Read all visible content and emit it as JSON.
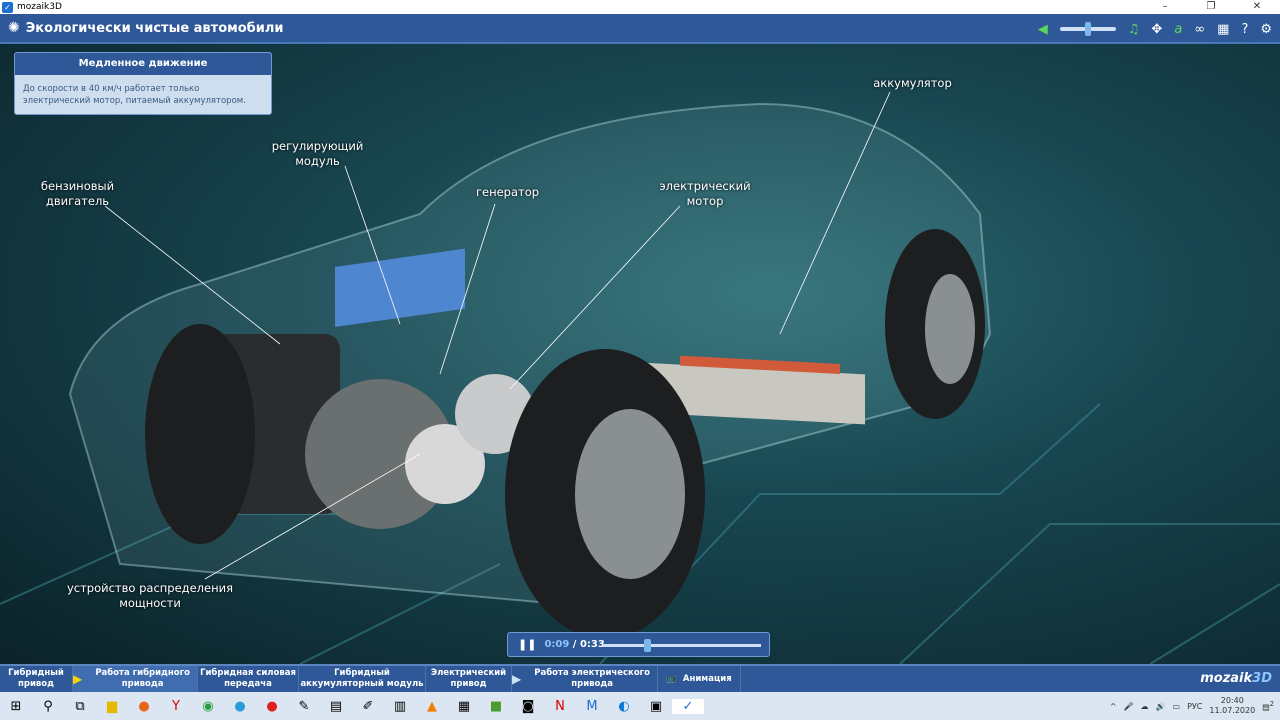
{
  "window": {
    "title": "mozaik3D",
    "controls": [
      "–",
      "❐",
      "✕"
    ]
  },
  "header": {
    "title": "Экологически чистые автомобили",
    "volume": 0.5
  },
  "toolbar": {
    "icons": [
      "speaker-icon",
      "music-icon",
      "move-icon",
      "text-icon",
      "link-icon",
      "grid-icon",
      "help-icon",
      "gear-icon"
    ],
    "help": "?"
  },
  "info": {
    "title": "Медленное движение",
    "text": "До скорости в 40 км/ч работает только электрический мотор, питаемый аккумулятором."
  },
  "labels": {
    "engine": "бензиновый двигатель",
    "module": "регулирующий модуль",
    "generator": "генератор",
    "motor": "электрический мотор",
    "battery": "аккумулятор",
    "splitter": "устройство распределения мощности"
  },
  "player": {
    "current": "0:09",
    "sep": "/",
    "total": "0:33",
    "progress": 0.27
  },
  "nav": {
    "tabs": [
      {
        "label": "Гибридный привод"
      },
      {
        "label": "Работа гибридного привода",
        "active": true
      },
      {
        "label": "Гибридная силовая передача"
      },
      {
        "label": "Гибридный аккумуляторный модуль"
      },
      {
        "label": "Электрический привод"
      },
      {
        "label": "Работа электрического привода"
      },
      {
        "label": "Анимация"
      }
    ],
    "brand_a": "mozaik",
    "brand_b": "3D"
  },
  "taskbar": {
    "lang": "РУС",
    "time": "20:40",
    "date": "11.07.2020",
    "notifications": "2"
  },
  "colors": {
    "accent": "#2e5897",
    "active_tab": "#3f6db0",
    "play": "#f5d300"
  }
}
